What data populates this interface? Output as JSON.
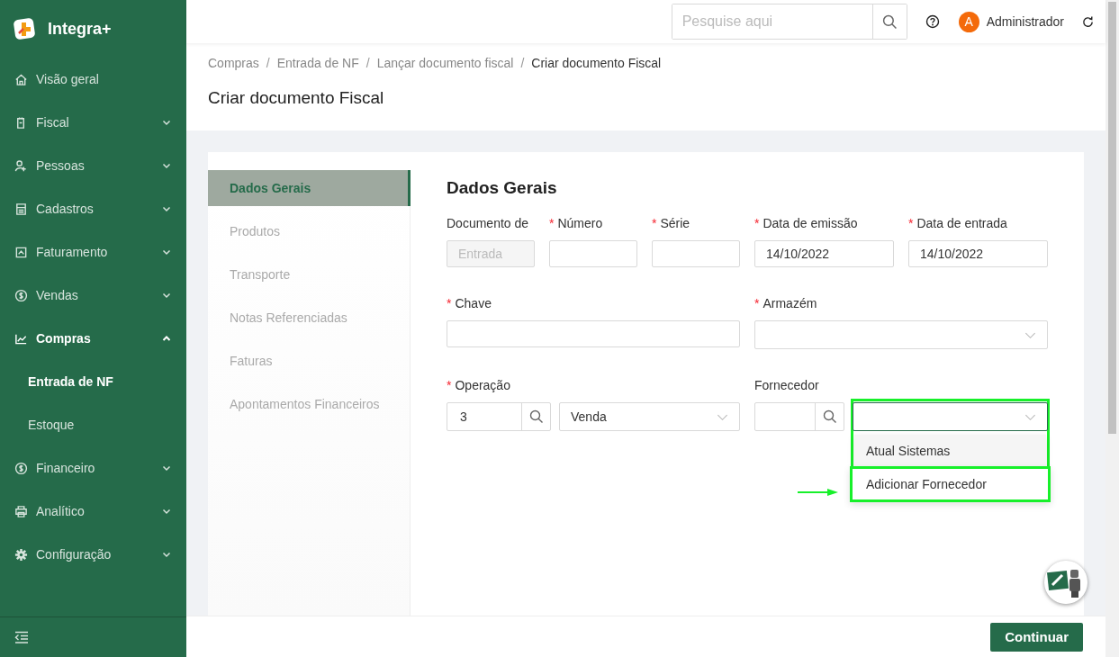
{
  "app": {
    "name": "Integra+"
  },
  "sidebar": {
    "items": [
      {
        "label": "Visão geral",
        "kind": "link",
        "selected": false
      },
      {
        "label": "Fiscal",
        "kind": "group",
        "expanded": false,
        "selected": false
      },
      {
        "label": "Pessoas",
        "kind": "group",
        "expanded": false,
        "selected": false
      },
      {
        "label": "Cadastros",
        "kind": "group",
        "expanded": false,
        "selected": false
      },
      {
        "label": "Faturamento",
        "kind": "group",
        "expanded": false,
        "selected": false
      },
      {
        "label": "Vendas",
        "kind": "group",
        "expanded": false,
        "selected": false
      },
      {
        "label": "Compras",
        "kind": "group",
        "expanded": true,
        "selected": true,
        "children": [
          {
            "label": "Entrada de NF",
            "selected": true
          },
          {
            "label": "Estoque",
            "selected": false
          }
        ]
      },
      {
        "label": "Financeiro",
        "kind": "group",
        "expanded": false,
        "selected": false
      },
      {
        "label": "Analítico",
        "kind": "group",
        "expanded": false,
        "selected": false
      },
      {
        "label": "Configuração",
        "kind": "group",
        "expanded": false,
        "selected": false
      }
    ]
  },
  "header": {
    "search": {
      "placeholder": "Pesquise aqui"
    },
    "user": {
      "initial": "A",
      "name": "Administrador"
    }
  },
  "breadcrumb": {
    "separator": [
      "/",
      "/",
      "/"
    ],
    "items": [
      "Compras",
      "Entrada de NF",
      "Lançar documento fiscal",
      "Criar documento Fiscal"
    ]
  },
  "page_title": "Criar documento Fiscal",
  "steps": [
    {
      "label": "Dados Gerais",
      "selected": true
    },
    {
      "label": "Produtos",
      "selected": false
    },
    {
      "label": "Transporte",
      "selected": false
    },
    {
      "label": "Notas Referenciadas",
      "selected": false
    },
    {
      "label": "Faturas",
      "selected": false
    },
    {
      "label": "Apontamentos Financeiros",
      "selected": false
    }
  ],
  "section_title": "Dados Gerais",
  "rows": [
    [
      {
        "label": "Documento de",
        "controls": [
          {
            "kind": "text",
            "value": "Entrada",
            "disabled": true
          }
        ]
      },
      {
        "label": "Número",
        "required_mark": "*",
        "controls": [
          {
            "kind": "text"
          }
        ]
      },
      {
        "label": "Série",
        "required_mark": "*",
        "controls": [
          {
            "kind": "text"
          }
        ]
      },
      {
        "label": "Data de emissão",
        "required_mark": "*",
        "controls": [
          {
            "kind": "text",
            "value": "14/10/2022"
          }
        ]
      },
      {
        "label": "Data de entrada",
        "required_mark": "*",
        "controls": [
          {
            "kind": "text",
            "value": "14/10/2022"
          }
        ]
      }
    ],
    [
      {
        "label": "Chave",
        "required_mark": "*",
        "controls": [
          {
            "kind": "text"
          }
        ]
      },
      {
        "label": "Armazém",
        "required_mark": "*",
        "controls": [
          {
            "kind": "select",
            "open": false
          }
        ]
      }
    ],
    [
      {
        "label": "Operação",
        "required_mark": "*",
        "controls": [
          {
            "kind": "lookup",
            "value": "3"
          },
          {
            "kind": "select",
            "value": "Venda",
            "open": false
          }
        ]
      },
      {
        "label": "Fornecedor",
        "controls": [
          {
            "kind": "lookup"
          },
          {
            "kind": "select",
            "open": true,
            "highlighted": true,
            "options": [
              {
                "label": "Atual Sistemas",
                "hovered": true,
                "highlighted": false
              },
              {
                "label": "Adicionar Fornecedor",
                "hovered": false,
                "highlighted": true
              }
            ]
          }
        ]
      }
    ]
  ],
  "footer": {
    "primary_button": "Continuar"
  }
}
